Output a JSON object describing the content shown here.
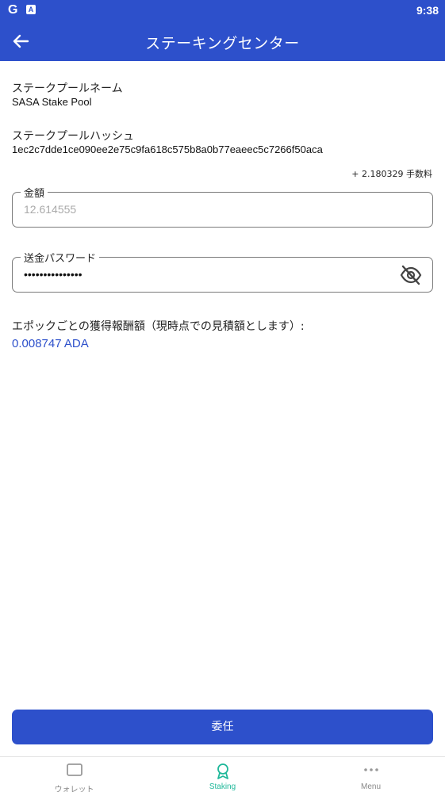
{
  "status_bar": {
    "time": "9:38",
    "g_icon": "G",
    "a_icon": "A"
  },
  "app_bar": {
    "title": "ステーキングセンター",
    "back_icon": "arrow-left"
  },
  "pool": {
    "name_label": "ステークプールネーム",
    "name_value": "SASA Stake Pool",
    "hash_label": "ステークプールハッシュ",
    "hash_value": "1ec2c7dde1ce090ee2e75c9fa618c575b8a0b77eaeec5c7266f50aca"
  },
  "fee_text": "+ 2.180329 手数料",
  "amount_field": {
    "label": "金額",
    "placeholder": "12.614555"
  },
  "password_field": {
    "label": "送金パスワード",
    "value": "•••••••••••••••",
    "toggle_icon": "eye-off"
  },
  "reward": {
    "label": "エポックごとの獲得報酬額（現時点での見積額とします）:",
    "value": "0.008747 ADA"
  },
  "delegate_button": "委任",
  "bottom_nav": {
    "items": [
      {
        "label": "ウォレット",
        "icon": "wallet-icon"
      },
      {
        "label": "Staking",
        "icon": "award-icon"
      },
      {
        "label": "Menu",
        "icon": "more-icon"
      }
    ]
  },
  "colors": {
    "primary": "#2d50cb",
    "accent": "#1fb89a"
  }
}
